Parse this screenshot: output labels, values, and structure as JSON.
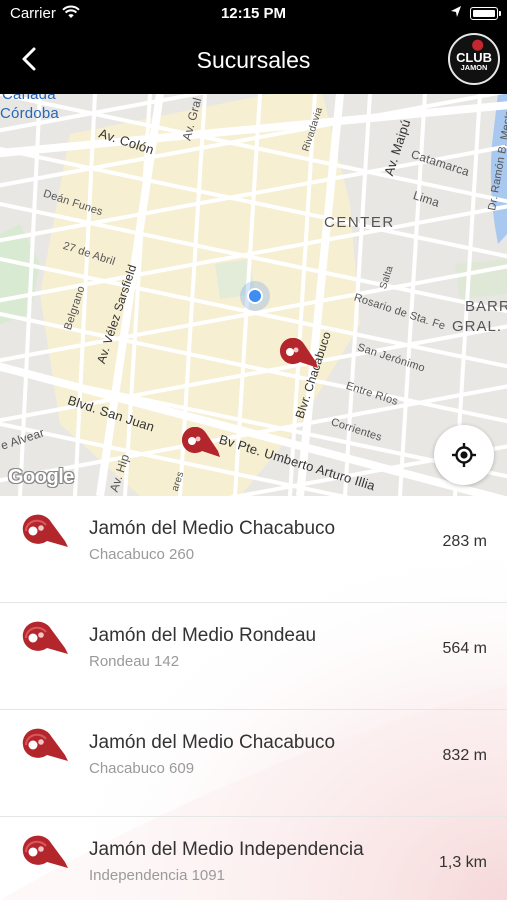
{
  "status_bar": {
    "carrier": "Carrier",
    "time": "12:15 PM"
  },
  "header": {
    "title": "Sucursales",
    "logo_text_top": "CLUB",
    "logo_text_bottom": "JAMON"
  },
  "map": {
    "labels": {
      "canada": "Cañada",
      "cordoba": "Córdoba",
      "av_colon": "Av. Colón",
      "av_gral": "Av. Gral",
      "rivadavia": "Rivadavia",
      "av_maipu": "Av. Maipú",
      "catamarca": "Catamarca",
      "lima": "Lima",
      "dean_funes": "Deán Funes",
      "center": "CENTER",
      "abril": "27 de Abril",
      "av_velez": "Av. Vélez Sarsfield",
      "belgrano": "Belgrano",
      "salta": "Salta",
      "rosario": "Rosario de Sta. Fe",
      "san_jeronimo": "San Jerónimo",
      "blvr_chacabuco": "Blvr. Chacabuco",
      "entre_rios": "Entre Ríos",
      "corrientes": "Corrientes",
      "blvd_san_juan": "Blvd. San Juan",
      "bv_illia": "Bv Pte. Umberto Arturo Illia",
      "alvear": "e Alvear",
      "av_hip": "Av. Hip",
      "ares": "ares",
      "barrio": "BARR",
      "gral": "GRAL.",
      "ramon": "Dr. Ramón B. Mestre"
    },
    "google": "Google",
    "brand_color": "#b3262c",
    "user_location_color": "#3f8df0"
  },
  "branches": [
    {
      "name": "Jamón del Medio Chacabuco",
      "address": "Chacabuco 260",
      "distance": "283 m"
    },
    {
      "name": "Jamón del Medio Rondeau",
      "address": "Rondeau 142",
      "distance": "564 m"
    },
    {
      "name": "Jamón del Medio Chacabuco",
      "address": "Chacabuco 609",
      "distance": "832 m"
    },
    {
      "name": "Jamón del Medio Independencia",
      "address": "Independencia 1091",
      "distance": "1,3 km"
    }
  ]
}
